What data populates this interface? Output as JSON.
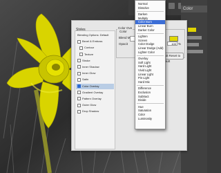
{
  "dialog": {
    "styles_title": "Styles",
    "style_items": [
      {
        "label": "Blending Options: Default",
        "checkbox": false
      },
      {
        "label": "Bevel & Emboss",
        "checkbox": true
      },
      {
        "label": "Contour",
        "checkbox": true,
        "indent": true
      },
      {
        "label": "Texture",
        "checkbox": true,
        "indent": true
      },
      {
        "label": "Stroke",
        "checkbox": true
      },
      {
        "label": "Inner Shadow",
        "checkbox": true
      },
      {
        "label": "Inner Glow",
        "checkbox": true
      },
      {
        "label": "Satin",
        "checkbox": true
      },
      {
        "label": "Color Overlay",
        "checkbox": true,
        "checked": true,
        "selected": true
      },
      {
        "label": "Gradient Overlay",
        "checkbox": true
      },
      {
        "label": "Pattern Overlay",
        "checkbox": true
      },
      {
        "label": "Outer Glow",
        "checkbox": true
      },
      {
        "label": "Drop Shadow",
        "checkbox": true
      }
    ],
    "group_title": "Color Ove",
    "sub_title": "Color",
    "blend_mode_label": "Blend Mod",
    "opacity_label": "Opacit",
    "opacity_value": "100",
    "opacity_unit": "%",
    "default_button": "Make Default  Reset to Default",
    "overlay_color": "#e1d800"
  },
  "blend_menu": {
    "groups": [
      [
        "Normal",
        "Dissolve"
      ],
      [
        "Darken",
        "Multiply",
        "Color Burn",
        "Linear Burn",
        "Darker Color"
      ],
      [
        "Lighten",
        "Screen",
        "Color Dodge",
        "Linear Dodge (Add)",
        "Lighter Color"
      ],
      [
        "Overlay",
        "Soft Light",
        "Hard Light",
        "Vivid Light",
        "Linear Light",
        "Pin Light",
        "Hard Mix"
      ],
      [
        "Difference",
        "Exclusion",
        "Subtract",
        "Divide"
      ],
      [
        "Hue",
        "Saturation",
        "Color",
        "Luminosity"
      ]
    ],
    "selected": "Color Burn",
    "selected_color": "#3c6ed6"
  },
  "panel": {
    "tab_label": "Color",
    "accent": "#e0d400"
  }
}
